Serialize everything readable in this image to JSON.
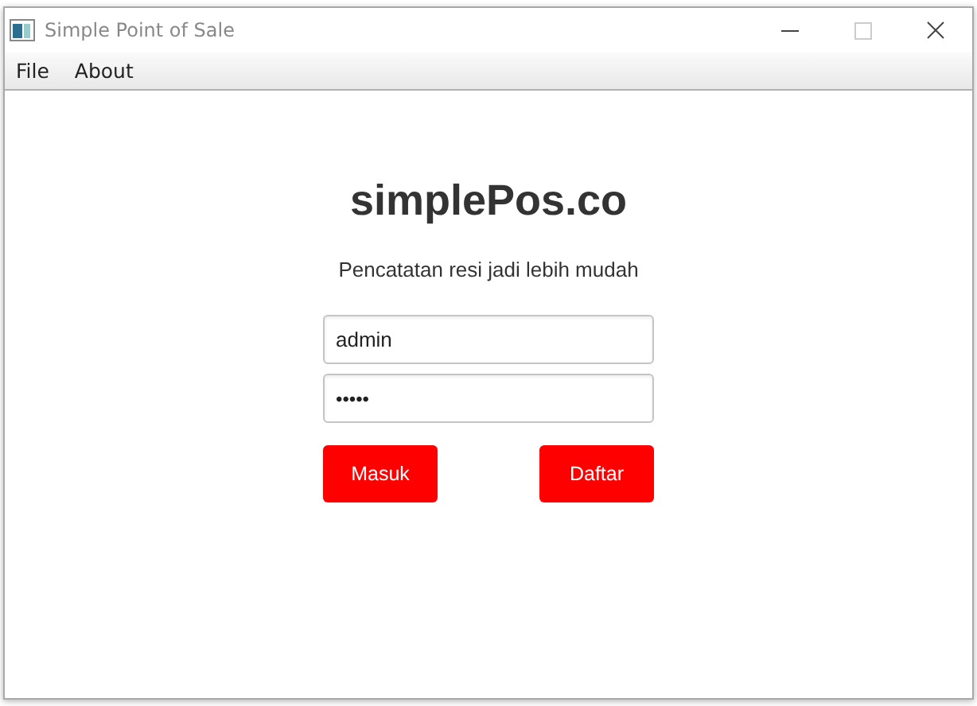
{
  "window": {
    "title": "Simple Point of Sale"
  },
  "menu": [
    "File",
    "About"
  ],
  "brand": "simplePos.co",
  "tagline": "Pencatatan resi jadi lebih mudah",
  "fields": [
    {
      "kind": "text",
      "value": "admin"
    },
    {
      "kind": "password",
      "value": "•••••"
    }
  ],
  "buttons": [
    "Masuk",
    "Daftar"
  ]
}
